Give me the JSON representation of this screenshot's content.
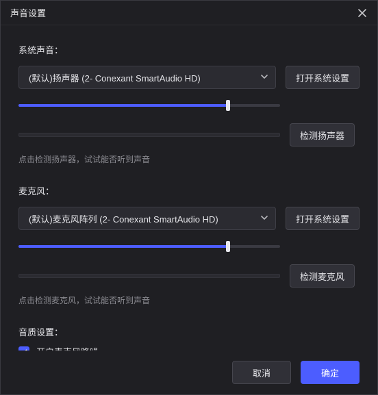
{
  "dialog": {
    "title": "声音设置"
  },
  "systemSound": {
    "label": "系统声音：",
    "device": "(默认)扬声器 (2- Conexant SmartAudio HD)",
    "openSettings": "打开系统设置",
    "volumePercent": 80,
    "testBtn": "检测扬声器",
    "hint": "点击检测扬声器，试试能否听到声音"
  },
  "microphone": {
    "label": "麦克风：",
    "device": "(默认)麦克风阵列 (2- Conexant SmartAudio HD)",
    "openSettings": "打开系统设置",
    "volumePercent": 80,
    "testBtn": "检测麦克风",
    "hint": "点击检测麦克风，试试能否听到声音"
  },
  "quality": {
    "label": "音质设置：",
    "noiseReduction": {
      "checked": true,
      "label": "开启麦克风降噪"
    }
  },
  "footer": {
    "cancel": "取消",
    "ok": "确定"
  }
}
